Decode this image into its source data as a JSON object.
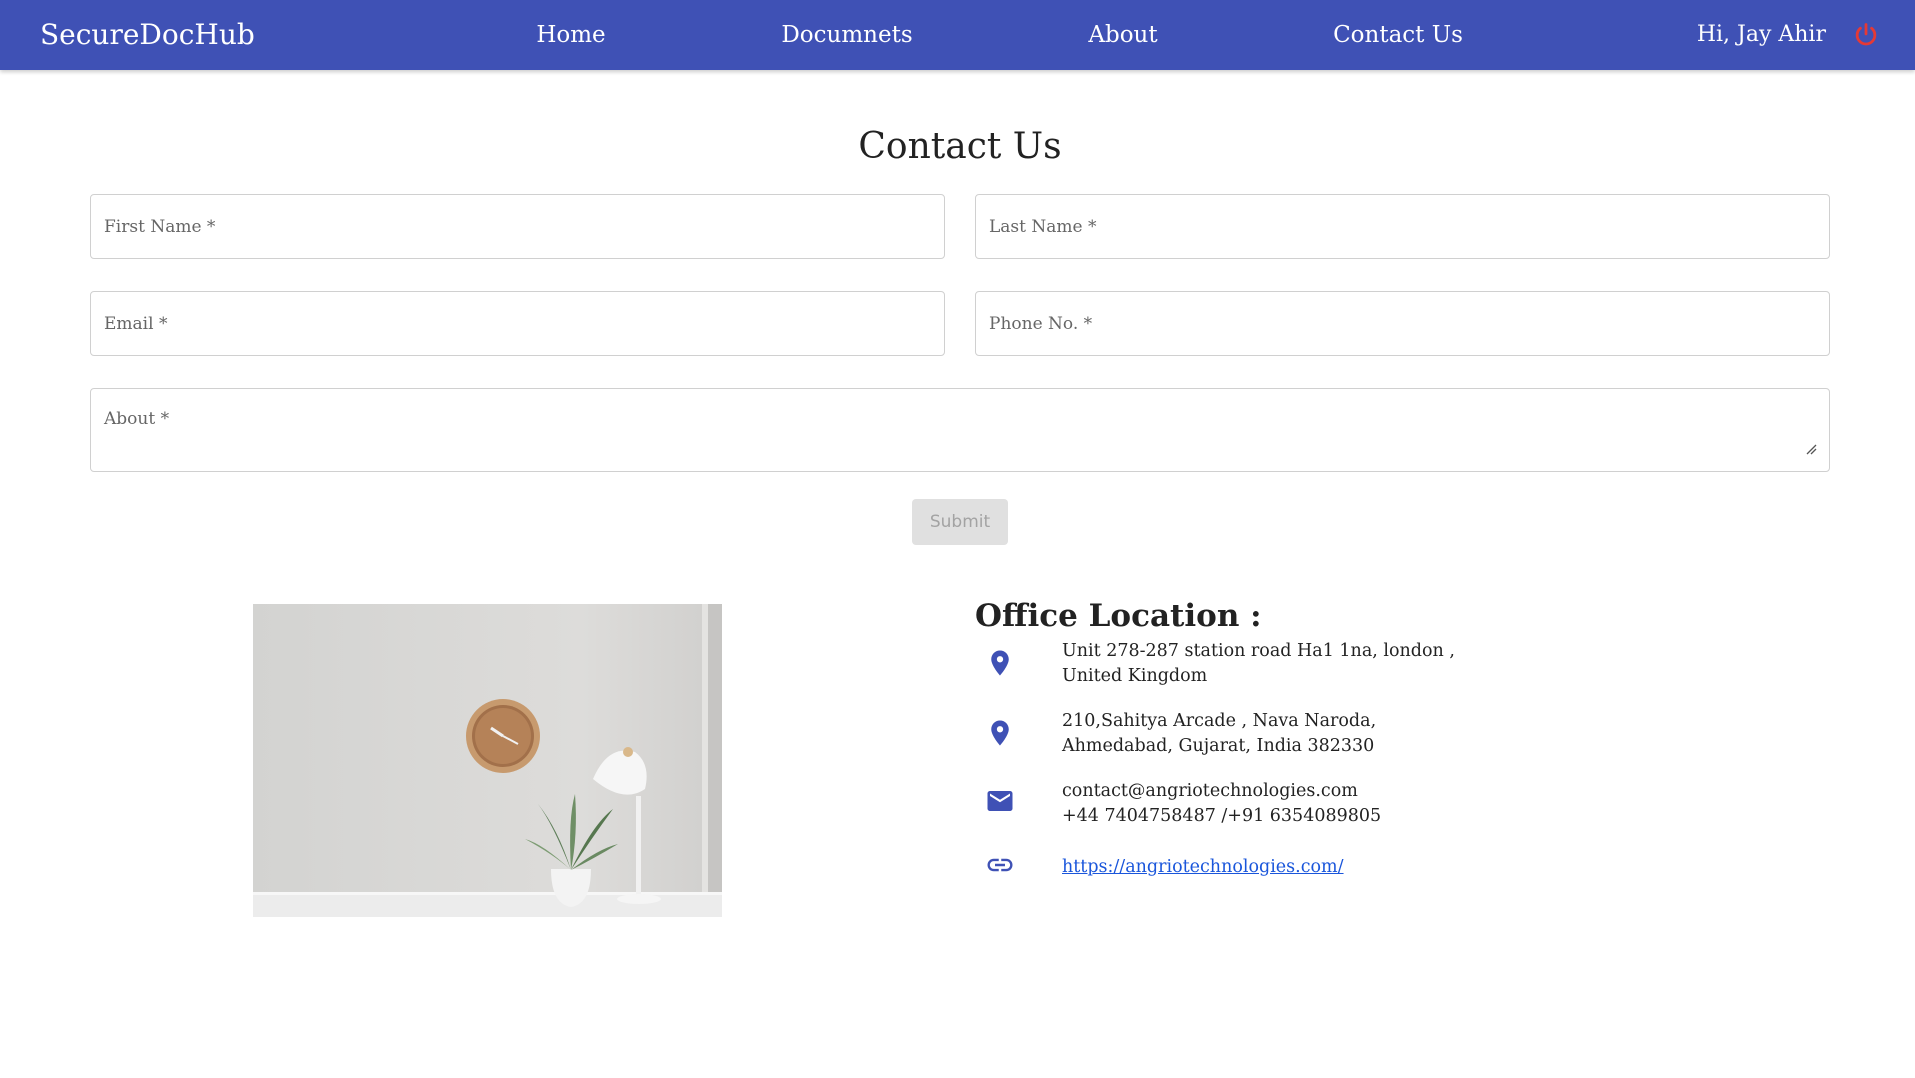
{
  "navbar": {
    "brand": "SecureDocHub",
    "links": [
      "Home",
      "Documnets",
      "About",
      "Contact Us"
    ],
    "greeting": "Hi, Jay Ahir",
    "logout_icon": "power-icon"
  },
  "page": {
    "title": "Contact Us"
  },
  "form": {
    "first_name_placeholder": "First Name *",
    "last_name_placeholder": "Last Name *",
    "email_placeholder": "Email *",
    "phone_placeholder": "Phone No. *",
    "about_placeholder": "About *",
    "submit_label": "Submit"
  },
  "office": {
    "title": "Office Location :",
    "entries": [
      {
        "icon": "location-pin-icon",
        "lines": [
          "Unit 278-287 station road Ha1 1na, london ,",
          "United Kingdom"
        ]
      },
      {
        "icon": "location-pin-icon",
        "lines": [
          "210,Sahitya Arcade , Nava Naroda,",
          "Ahmedabad, Gujarat, India 382330"
        ]
      },
      {
        "icon": "mail-icon",
        "lines": [
          "contact@angriotechnologies.com",
          "+44 7404758487 /+91 6354089805"
        ]
      },
      {
        "icon": "link-icon",
        "lines": [
          "https://angriotechnologies.com/"
        ]
      }
    ]
  },
  "colors": {
    "navbar": "#3f51b5",
    "icon": "#3f51b5",
    "logout": "#e53935",
    "link": "#1a56db"
  }
}
